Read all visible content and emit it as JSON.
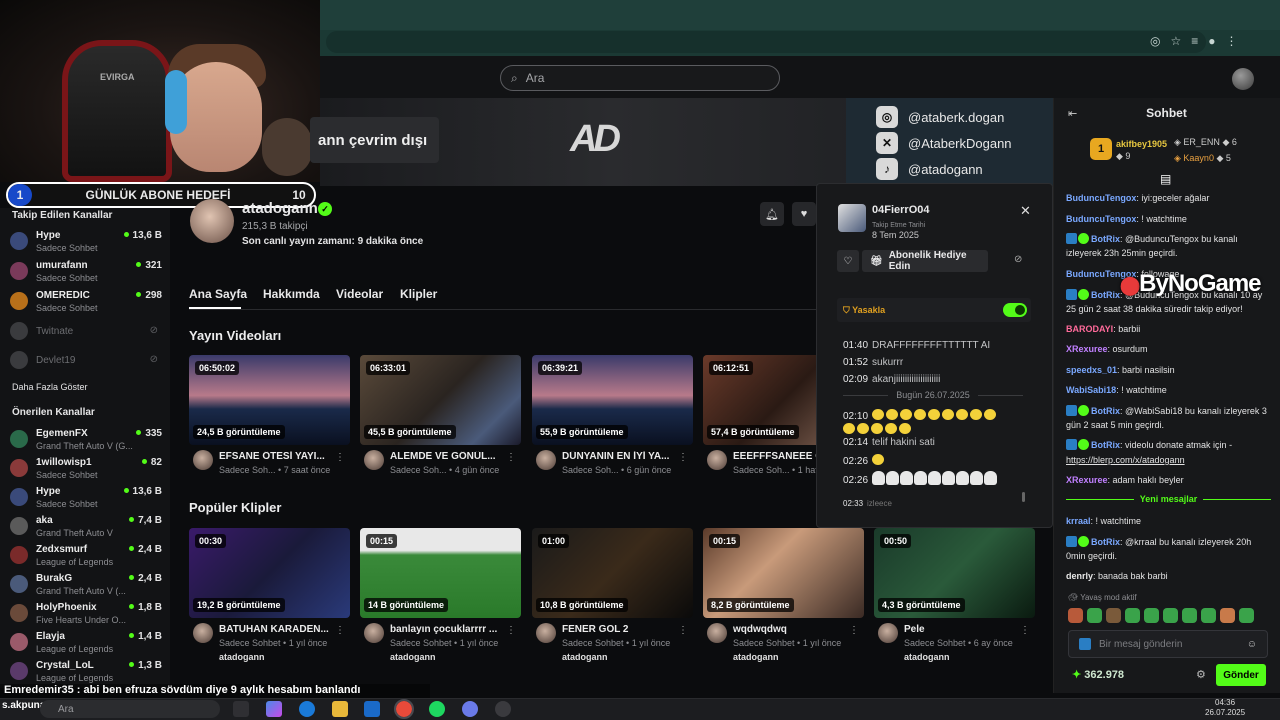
{
  "search": {
    "placeholder": "Ara"
  },
  "webcam": {
    "chair_text": "EVIRGA"
  },
  "sub_goal": {
    "current": "1",
    "label": "GÜNLÜK ABONE HEDEFİ",
    "target": "10"
  },
  "banner": {
    "offline_text": "ann çevrim dışı",
    "logo_text": "AD",
    "socials": [
      {
        "icon": "instagram-icon",
        "handle": "@ataberk.dogan"
      },
      {
        "icon": "x-icon",
        "handle": "@AtaberkDogann"
      },
      {
        "icon": "tiktok-icon",
        "handle": "@atadogann"
      }
    ]
  },
  "sidebar": {
    "followed_title": "Takip Edilen Kanallar",
    "followed": [
      {
        "name": "Hype",
        "sub": "Sadece Sohbet",
        "count": "13,6 B",
        "color": "#3a4a7a"
      },
      {
        "name": "umurafann",
        "sub": "Sadece Sohbet",
        "count": "321",
        "color": "#7a3a5a"
      },
      {
        "name": "OMEREDIC",
        "sub": "Sadece Sohbet",
        "count": "298",
        "color": "#b8701a"
      }
    ],
    "offline": [
      {
        "name": "Twitnate"
      },
      {
        "name": "Devlet19"
      }
    ],
    "show_more": "Daha Fazla Göster",
    "suggested_title": "Önerilen Kanallar",
    "suggested": [
      {
        "name": "EgemenFX",
        "sub": "Grand Theft Auto V (G...",
        "count": "335",
        "color": "#2a6a4a"
      },
      {
        "name": "1willowisp1",
        "sub": "Sadece Sohbet",
        "count": "82",
        "color": "#8a3a3a"
      },
      {
        "name": "Hype",
        "sub": "Sadece Sohbet",
        "count": "13,6 B",
        "color": "#3a4a7a"
      },
      {
        "name": "aka",
        "sub": "Grand Theft Auto V",
        "count": "7,4 B",
        "color": "#5a5a5a"
      },
      {
        "name": "Zedxsmurf",
        "sub": "League of Legends",
        "count": "2,4 B",
        "color": "#7a2a2a"
      },
      {
        "name": "BurakG",
        "sub": "Grand Theft Auto V (...",
        "count": "2,4 B",
        "color": "#4a5a7a"
      },
      {
        "name": "HolyPhoenix",
        "sub": "Five Hearts Under O...",
        "count": "1,8 B",
        "color": "#6a4a3a"
      },
      {
        "name": "Elayja",
        "sub": "League of Legends",
        "count": "1,4 B",
        "color": "#9a5a6a"
      },
      {
        "name": "Crystal_LoL",
        "sub": "League of Legends",
        "count": "1,3 B",
        "color": "#5a3a6a"
      }
    ]
  },
  "channel": {
    "name": "atadogann",
    "followers": "215,3 B takipçi",
    "last_stream": "Son canlı yayın zamanı: 9 dakika önce",
    "tabs": [
      "Ana Sayfa",
      "Hakkımda",
      "Videolar",
      "Klipler"
    ]
  },
  "videos": {
    "title": "Yayın Videoları",
    "items": [
      {
        "duration": "06:50:02",
        "views": "24,5 B görüntüleme",
        "title": "EFSANE ÖTESİ YAYI...",
        "meta": "Sadece Soh... • 7 saat önce",
        "bg": "linear-gradient(180deg,#3a3a6a 0%,#b87a8a 45%,#1a2a4a 60%,#0a1020 100%)"
      },
      {
        "duration": "06:33:01",
        "views": "45,5 B görüntüleme",
        "title": "ALEMDE VE GÖNÜL...",
        "meta": "Sadece Soh... • 4 gün önce",
        "bg": "linear-gradient(135deg,#5a4a3a,#2a2420 50%,#4a5a7a 80%,#1a1a2a)"
      },
      {
        "duration": "06:39:21",
        "views": "55,9 B görüntüleme",
        "title": "DÜNYANIN EN İYİ YA...",
        "meta": "Sadece Soh... • 6 gün önce",
        "bg": "linear-gradient(180deg,#3a3a6a 0%,#b87a8a 45%,#1a2a4a 60%,#0a1020 100%)"
      },
      {
        "duration": "06:12:51",
        "views": "57,4 B görüntüleme",
        "title": "EEEFFFSANEEE GE",
        "meta": "Sadece Soh... • 1 hafta",
        "bg": "linear-gradient(135deg,#6a3a2a,#2a1a14 50%,#8a6a5a)"
      }
    ]
  },
  "clips": {
    "title": "Popüler Klipler",
    "items": [
      {
        "duration": "00:30",
        "views": "19,2 B görüntüleme",
        "title": "BATUHAN KARADEN...",
        "meta": "Sadece Sohbet • 1 yıl önce",
        "channel": "atadogann",
        "bg": "linear-gradient(135deg,#3a1a6a,#1a1a3a 50%,#2a3a7a)"
      },
      {
        "duration": "00:15",
        "views": "14 B görüntüleme",
        "title": "banlayın çocuklarrrr ...",
        "meta": "Sadece Sohbet • 1 yıl önce",
        "channel": "atadogann",
        "bg": "linear-gradient(180deg,#e8e8e8 0%,#e8e8e8 25%,#3a8a3a 30%,#2a7a2a 100%)"
      },
      {
        "duration": "01:00",
        "views": "10,8 B görüntüleme",
        "title": "FENER GOL 2",
        "meta": "Sadece Sohbet • 1 yıl önce",
        "channel": "atadogann",
        "bg": "linear-gradient(135deg,#1a1a1a,#3a2a1a 50%,#0a0a0a)"
      },
      {
        "duration": "00:15",
        "views": "8,2 B görüntüleme",
        "title": "wqdwqdwq",
        "meta": "Sadece Sohbet • 1 yıl önce",
        "channel": "atadogann",
        "bg": "linear-gradient(135deg,#5a3a2a,#c89a7a 40%,#3a2a24)"
      },
      {
        "duration": "00:50",
        "views": "4,3 B görüntüleme",
        "title": "Pele",
        "meta": "Sadece Sohbet • 6 ay önce",
        "channel": "atadogann",
        "bg": "linear-gradient(135deg,#1a3a2a,#2a5a3a 50%,#0a1a10)"
      }
    ]
  },
  "popup": {
    "username": "04FierrO04",
    "follow_label": "Takip Etme Tarihi",
    "follow_date": "8 Tem 2025",
    "gift_label": "Abonelik Hediye Edin",
    "ban_label": "Yasakla",
    "lines": [
      {
        "time": "01:40",
        "text": "DRAFFFFFFFFTTTTTT AI"
      },
      {
        "time": "01:52",
        "text": "sukurrr"
      },
      {
        "time": "02:09",
        "text": "akanjiiiiiiiiiiiiiiiiiiii"
      }
    ],
    "day_sep": "Bugün 26.07.2025",
    "lines2": [
      {
        "time": "02:10",
        "text": ""
      },
      {
        "time": "02:14",
        "text": "telif hakini sati"
      },
      {
        "time": "02:26",
        "text": ""
      },
      {
        "time": "02:26",
        "text": ""
      },
      {
        "time": "02:33",
        "text": "izleece"
      }
    ]
  },
  "chat": {
    "title": "Sohbet",
    "top_gifters": [
      {
        "rank": "1",
        "name": "akifbey1905",
        "count": "9"
      },
      {
        "name": "ER_ENN",
        "count": "6"
      },
      {
        "name": "Kaayn0",
        "count": "5"
      }
    ],
    "messages": [
      {
        "user": "BuduncuTengox",
        "color": "#7aa8ff",
        "text": ": iyi:geceler ağalar"
      },
      {
        "user": "BuduncuTengox",
        "color": "#7aa8ff",
        "text": ": ! watchtime"
      },
      {
        "user": "BotRix",
        "color": "#7aa8ff",
        "bot": true,
        "text": ": @BuduncuTengox bu kanalı izleyerek 23h 25min geçirdi."
      },
      {
        "user": "BuduncuTengox",
        "color": "#7aa8ff",
        "text": ": followage"
      },
      {
        "user": "BotRix",
        "color": "#7aa8ff",
        "bot": true,
        "text": ": @BuduncuTengox bu kanalı 10 ay 25 gün 2 saat 38 dakika süredir takip ediyor!"
      },
      {
        "user": "BARODAYI",
        "color": "#ff6a9a",
        "text": ": barbii"
      },
      {
        "user": "XRexuree",
        "color": "#c080ff",
        "text": ": osurdum"
      },
      {
        "user": "speedxs_01",
        "color": "#7aa8ff",
        "text": ": barbi nasilsin"
      },
      {
        "user": "WabiSabi18",
        "color": "#7aa8ff",
        "text": ": ! watchtime"
      },
      {
        "user": "BotRix",
        "color": "#7aa8ff",
        "bot": true,
        "text": ": @WabiSabi18 bu kanalı izleyerek 3 gün 2 saat 5 min geçirdi."
      },
      {
        "user": "BotRix",
        "color": "#7aa8ff",
        "bot": true,
        "text": ": videolu donate atmak için - "
      },
      {
        "user": "XRexuree",
        "color": "#c080ff",
        "text": ": adam haklı beyler"
      }
    ],
    "donate_link": "https://blerp.com/x/atadogann",
    "new_messages": "Yeni mesajlar",
    "messages2": [
      {
        "user": "krraal",
        "color": "#7aa8ff",
        "text": ": ! watchtime"
      },
      {
        "user": "BotRix",
        "color": "#7aa8ff",
        "bot": true,
        "text": ": @krraal bu kanalı izleyerek 20h 0min geçirdi."
      },
      {
        "user": "denrly",
        "color": "#e8e8e8",
        "text": ": banada bak barbi"
      }
    ],
    "slow_mode": "Yavaş mod aktif",
    "input_placeholder": "Bir mesaj gönderin",
    "points": "362.978",
    "send_label": "Gönder"
  },
  "watermark": "ByNoGame",
  "ticker": "Emredemir35 : abi ben efruza sövdüm diye 9 aylık hesabım banlandı",
  "taskbar": {
    "user": "s.akpunar/",
    "search_placeholder": "Ara",
    "time": "04:36",
    "date": "26.07.2025"
  }
}
